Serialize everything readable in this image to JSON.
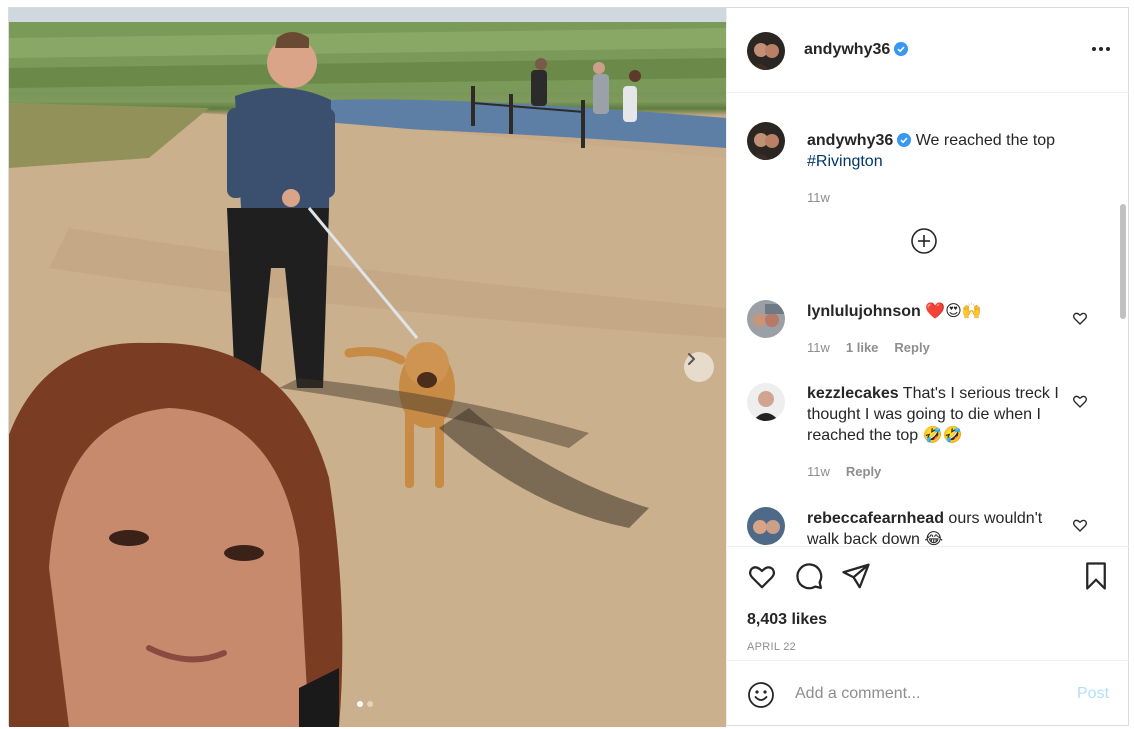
{
  "post": {
    "username": "andywhy36",
    "verified": true,
    "more_icon": "more-horizontal-icon",
    "caption": {
      "text": "We reached the top",
      "hashtag": "#Rivington",
      "time": "11w"
    },
    "load_more_icon": "plus-circle-icon",
    "comments": [
      {
        "username": "lynlulujohnson",
        "text": "❤️😍🙌",
        "time": "11w",
        "likes": "1 like",
        "reply": "Reply"
      },
      {
        "username": "kezzlecakes",
        "text": "That's I serious treck I thought I was going to die when I reached the top 🤣🤣",
        "time": "11w",
        "reply": "Reply"
      },
      {
        "username": "rebeccafearnhead",
        "text": "ours wouldn't walk back down 😂"
      }
    ],
    "actions": {
      "like_icon": "heart-icon",
      "comment_icon": "comment-icon",
      "share_icon": "send-icon",
      "save_icon": "bookmark-icon"
    },
    "likes_count": "8,403 likes",
    "date": "APRIL 22",
    "add_comment": {
      "emoji_icon": "emoji-icon",
      "placeholder": "Add a comment...",
      "post_label": "Post"
    },
    "carousel": {
      "slide_count": 2,
      "active_slide": 1,
      "next_icon": "chevron-right-icon"
    },
    "colors": {
      "link": "#00376b",
      "verified": "#3897f0",
      "muted": "#8e8e8e",
      "post_disabled": "#b2dffc"
    }
  }
}
